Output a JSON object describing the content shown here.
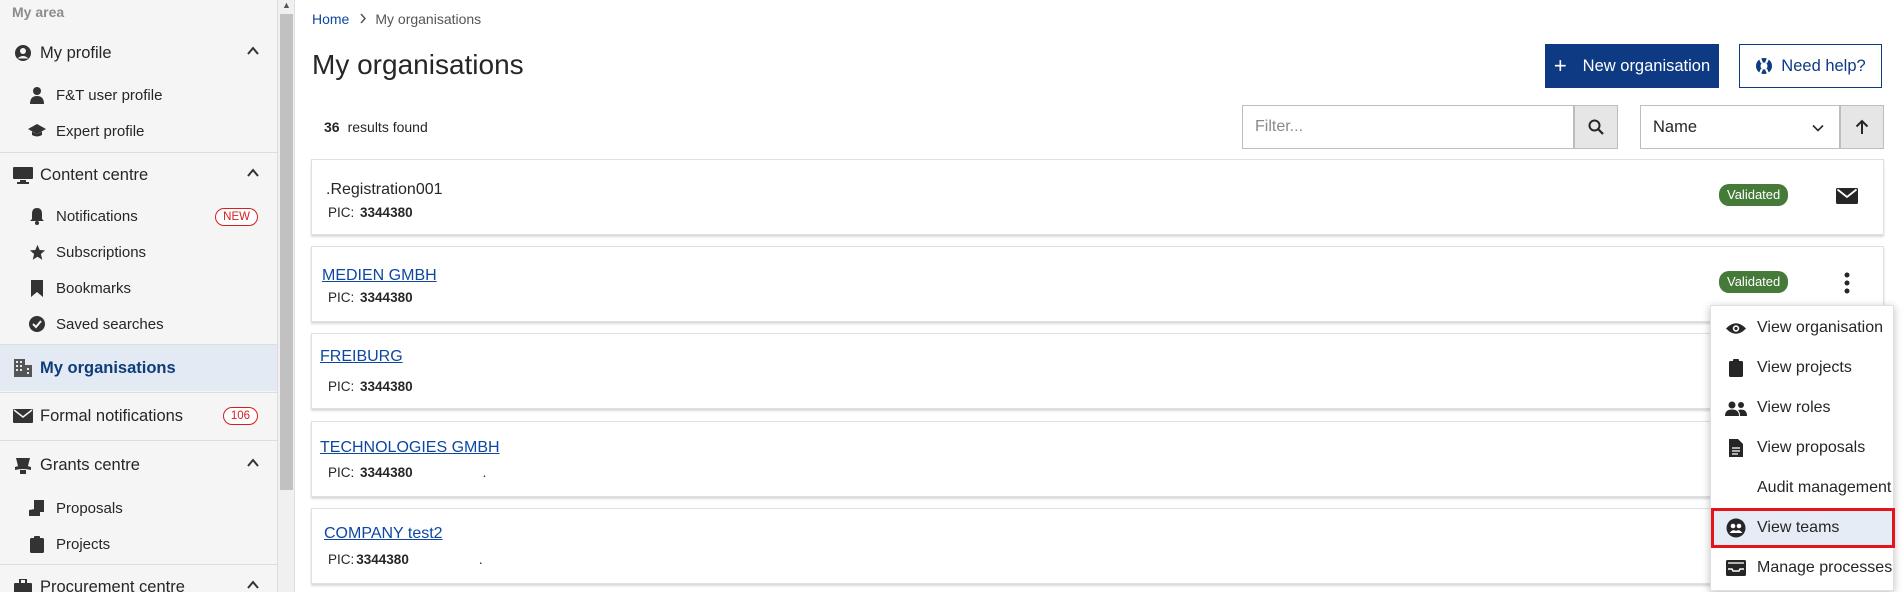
{
  "sidebar": {
    "area_title": "My area",
    "my_profile": {
      "label": "My profile",
      "items": [
        {
          "label": "F&T user profile",
          "icon": "user-icon"
        },
        {
          "label": "Expert profile",
          "icon": "graduation-cap-icon"
        }
      ]
    },
    "content_centre": {
      "label": "Content centre",
      "items": [
        {
          "label": "Notifications",
          "icon": "bell-icon",
          "badge": "NEW"
        },
        {
          "label": "Subscriptions",
          "icon": "star-icon"
        },
        {
          "label": "Bookmarks",
          "icon": "bookmark-icon"
        },
        {
          "label": "Saved searches",
          "icon": "check-circle-icon"
        }
      ]
    },
    "my_organisations": {
      "label": "My organisations",
      "active": true
    },
    "formal_notifications": {
      "label": "Formal notifications",
      "badge": "106"
    },
    "grants_centre": {
      "label": "Grants centre",
      "items": [
        {
          "label": "Proposals",
          "icon": "hand-document-icon"
        },
        {
          "label": "Projects",
          "icon": "clipboard-icon"
        }
      ]
    },
    "procurement_centre": {
      "label": "Procurement centre"
    }
  },
  "breadcrumb": {
    "home": "Home",
    "current": "My organisations"
  },
  "page_title": "My organisations",
  "actions": {
    "new_org": "New organisation",
    "help": "Need help?"
  },
  "results": {
    "count": "36",
    "label": "results found"
  },
  "filter": {
    "placeholder": "Filter..."
  },
  "sort": {
    "selected": "Name",
    "direction": "ascending"
  },
  "organisations": [
    {
      "name": "Registration001",
      "prefix": ".",
      "pic_label": "PIC:",
      "pic": "3344380",
      "status": "Validated",
      "action": "envelope-icon"
    },
    {
      "name": "MEDIEN GMBH",
      "pic_label": "PIC:",
      "pic": "3344380",
      "status": "Validated",
      "action": "kebab-icon"
    },
    {
      "name": "FREIBURG",
      "pic_label": "PIC:",
      "pic": "3344380"
    },
    {
      "name": "TECHNOLOGIES GMBH",
      "pic_label": "PIC:",
      "pic": "3344380",
      "suffix": "."
    },
    {
      "name": "COMPANY test2",
      "pic_label": "PIC:",
      "pic": "3344380",
      "suffix": "."
    }
  ],
  "menu": {
    "items": [
      {
        "label": "View organisation",
        "icon": "eye-icon"
      },
      {
        "label": "View projects",
        "icon": "clipboard-icon"
      },
      {
        "label": "View roles",
        "icon": "users-icon"
      },
      {
        "label": "View proposals",
        "icon": "document-icon"
      },
      {
        "label": "Audit management",
        "icon": ""
      },
      {
        "label": "View teams",
        "icon": "team-icon",
        "highlighted": true
      },
      {
        "label": "Manage processes",
        "icon": "inbox-icon"
      }
    ]
  },
  "colors": {
    "primary": "#0e3a83",
    "status_green": "#467a39",
    "highlight_red": "#e3151a",
    "badge_red": "#d42020"
  }
}
